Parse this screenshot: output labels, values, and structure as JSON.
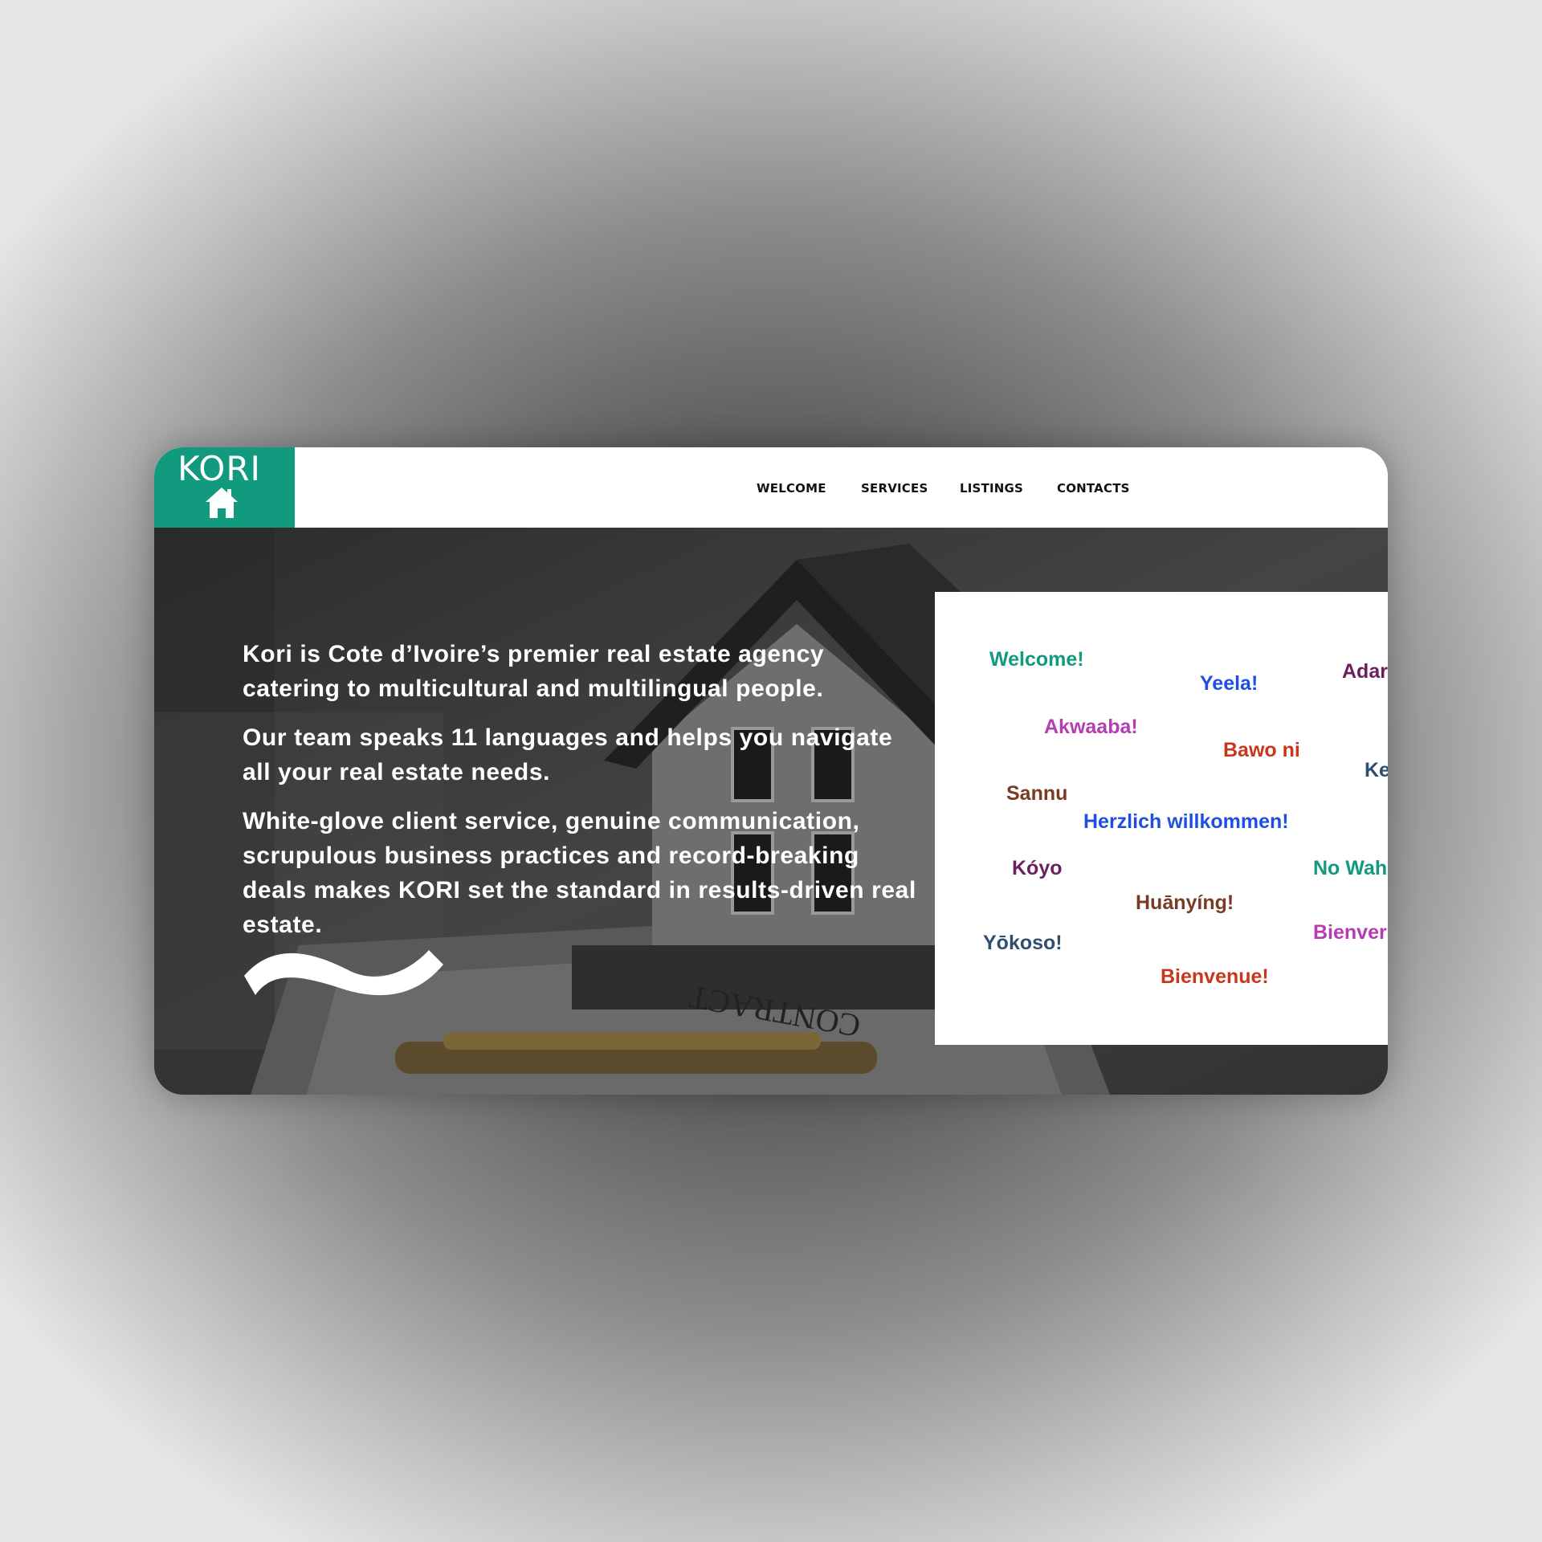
{
  "brand": {
    "name": "KORI",
    "icon": "house-icon",
    "color": "#129a7f"
  },
  "nav": [
    "WELCOME",
    "SERVICES",
    "LISTINGS",
    "CONTACTS"
  ],
  "hero": {
    "paragraphs": [
      "Kori is Cote d’Ivoire’s premier real estate agency catering to multicultural and multilingual people.",
      "Our team speaks 11 languages and helps you navigate all your real estate needs.",
      "White-glove client service, genuine communication, scrupulous business practices and record-breaking deals makes KORI set the standard in results-driven real estate."
    ],
    "background_image": "house-model-on-contract-photo",
    "background_text": "CONTRACT"
  },
  "greetings": [
    {
      "text": "Welcome!",
      "color": "#129a7f"
    },
    {
      "text": "Yeela!",
      "color": "#1f4fe0"
    },
    {
      "text": "Adar",
      "color": "#6b1f5e"
    },
    {
      "text": "Akwaaba!",
      "color": "#b43db4"
    },
    {
      "text": "Bawo ni",
      "color": "#c8361c"
    },
    {
      "text": "Ke",
      "color": "#2f4f6f"
    },
    {
      "text": "Sannu",
      "color": "#7a3b24"
    },
    {
      "text": "Herzlich willkommen!",
      "color": "#1f4fe0"
    },
    {
      "text": "Kóyo",
      "color": "#6b1f5e"
    },
    {
      "text": "No Wah",
      "color": "#129a7f"
    },
    {
      "text": "Huānyíng!",
      "color": "#7a3b24"
    },
    {
      "text": "Bienver",
      "color": "#b43db4"
    },
    {
      "text": "Yōkoso!",
      "color": "#2f4f6f"
    },
    {
      "text": "Bienvenue!",
      "color": "#c8361c"
    }
  ]
}
